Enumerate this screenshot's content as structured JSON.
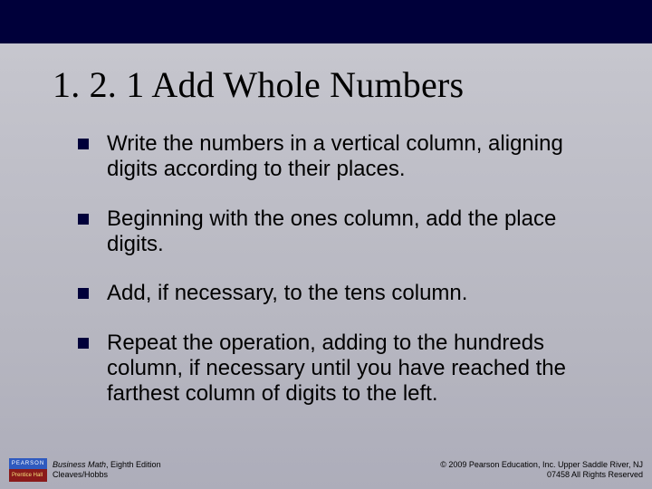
{
  "slide": {
    "title": "1. 2. 1 Add Whole Numbers",
    "bullets": [
      "Write the numbers in a vertical column, aligning digits according to their places.",
      "Beginning with the ones column, add the place digits.",
      "Add, if necessary, to the tens column.",
      "Repeat the operation, adding to the hundreds column, if necessary until you have reached the farthest column of digits to the left."
    ]
  },
  "footer": {
    "logo_top": "PEARSON",
    "logo_bottom": "Prentice Hall",
    "book_title": "Business Math",
    "edition": ", Eighth Edition",
    "authors": "Cleaves/Hobbs",
    "copyright_line1": "© 2009 Pearson Education, Inc. Upper Saddle River, NJ",
    "copyright_line2": "07458  All Rights Reserved"
  }
}
